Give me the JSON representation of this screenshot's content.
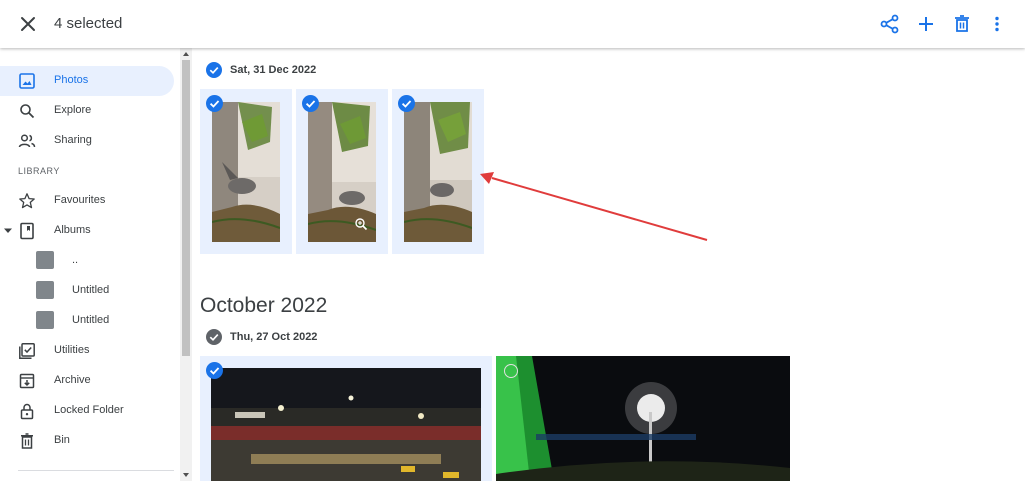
{
  "header": {
    "selection_text": "4 selected",
    "close_icon": "close-icon",
    "actions": [
      "share-icon",
      "add-icon",
      "delete-icon",
      "more-vert-icon"
    ]
  },
  "sidebar": {
    "items": [
      {
        "label": "Photos",
        "icon": "photos-icon",
        "active": true
      },
      {
        "label": "Explore",
        "icon": "search-icon"
      },
      {
        "label": "Sharing",
        "icon": "people-icon"
      }
    ],
    "library_label": "LIBRARY",
    "library_items": [
      {
        "label": "Favourites",
        "icon": "star-icon"
      },
      {
        "label": "Albums",
        "icon": "album-icon"
      }
    ],
    "albums": [
      {
        "label": ".."
      },
      {
        "label": "Untitled"
      },
      {
        "label": "Untitled"
      }
    ],
    "more_items": [
      {
        "label": "Utilities",
        "icon": "utilities-icon"
      },
      {
        "label": "Archive",
        "icon": "archive-icon"
      },
      {
        "label": "Locked Folder",
        "icon": "lock-icon"
      },
      {
        "label": "Bin",
        "icon": "trash-icon"
      }
    ]
  },
  "content": {
    "group1_date": "Sat, 31 Dec 2022",
    "month_heading": "October 2022",
    "group2_date": "Thu, 27 Oct 2022"
  },
  "colors": {
    "accent": "#1a73e8",
    "selected_bg": "#e8f0fe",
    "annotation_arrow": "#e03c3c"
  }
}
